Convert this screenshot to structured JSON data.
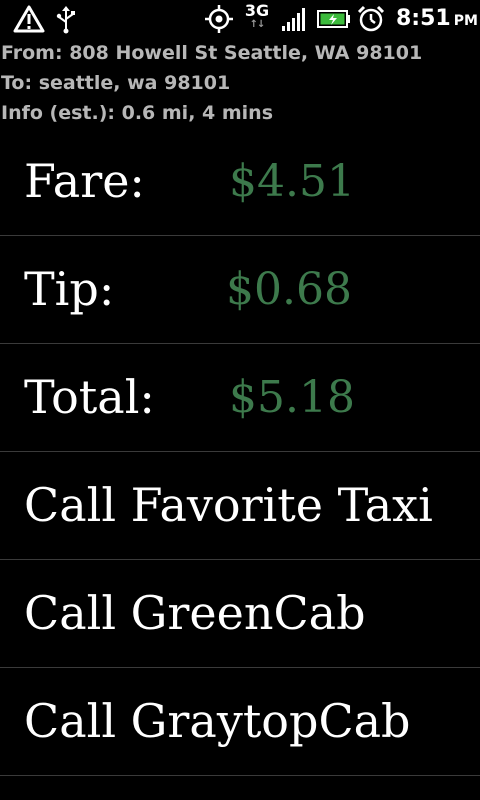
{
  "status_bar": {
    "icons": [
      "warning-icon",
      "usb-icon",
      "gps-icon",
      "signal-icon",
      "battery-charging-icon",
      "alarm-icon"
    ],
    "network_type": "3G",
    "time": "8:51",
    "ampm": "PM"
  },
  "trip": {
    "from": "From:  808 Howell St Seattle, WA 98101",
    "to": "To: seattle, wa 98101",
    "info": "Info (est.): 0.6 mi, 4 mins"
  },
  "fare": {
    "fare_label": "Fare:",
    "fare_value": "$4.51",
    "tip_label": "Tip:",
    "tip_value": "$0.68",
    "total_label": "Total:",
    "total_value": "$5.18",
    "value_color": "#3d7a4c"
  },
  "actions": {
    "call_favorite": "Call Favorite Taxi",
    "call_greencab": "Call GreenCab",
    "call_graytopcab": "Call GraytopCab"
  }
}
